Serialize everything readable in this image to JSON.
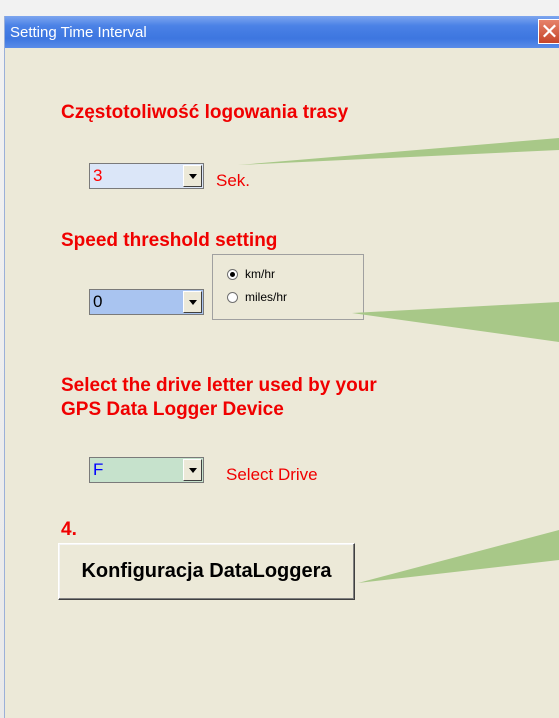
{
  "window": {
    "title": "Setting Time Interval",
    "close_glyph": "✕"
  },
  "log_interval": {
    "heading": "Częstotoliwość logowania trasy",
    "value": "3",
    "unit": "Sek.",
    "field_bg": "#dbe6f8",
    "value_color": "#ff0000"
  },
  "speed": {
    "heading": "Speed threshold setting",
    "value": "0",
    "field_bg": "#a9c4f0",
    "options": [
      {
        "label": "km/hr",
        "selected": true
      },
      {
        "label": "miles/hr",
        "selected": false
      }
    ]
  },
  "drive": {
    "heading_line1": "Select the drive letter used by your",
    "heading_line2": "GPS Data Logger Device",
    "value": "F",
    "label": "Select Drive",
    "field_bg": "#c6e2cc",
    "value_color": "#0000ff"
  },
  "step": {
    "number": "4."
  },
  "config_button": {
    "label": "Konfiguracja DataLoggera"
  },
  "colors": {
    "accent_red": "#f00000",
    "callout_green": "#a8c888",
    "titlebar_blue": "#3d76e0"
  }
}
